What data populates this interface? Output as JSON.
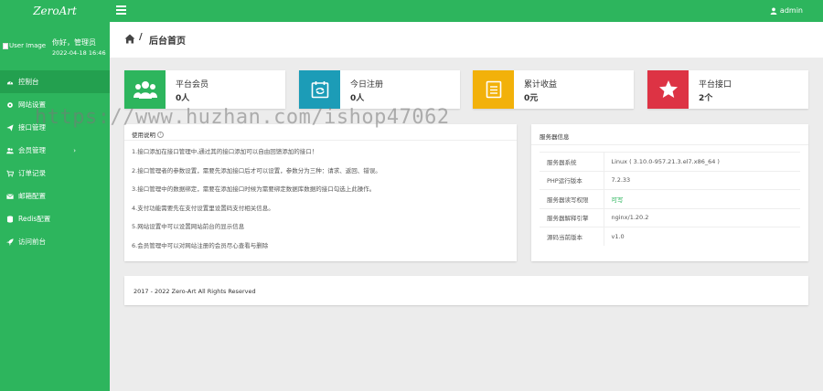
{
  "app": {
    "logo": "ZeroArt"
  },
  "topbar": {
    "user_name": "admin"
  },
  "sidebar": {
    "avatar_alt": "User Image",
    "greeting": "你好，管理员",
    "datetime": "2022-04-18 16:46",
    "items": [
      {
        "label": "控制台",
        "icon": "dashboard-icon",
        "active": true
      },
      {
        "label": "网站设置",
        "icon": "gear-icon"
      },
      {
        "label": "接口管理",
        "icon": "paper-plane-icon"
      },
      {
        "label": "会员管理",
        "icon": "users-icon",
        "has_submenu": true
      },
      {
        "label": "订单记录",
        "icon": "cart-icon"
      },
      {
        "label": "邮箱配置",
        "icon": "envelope-icon"
      },
      {
        "label": "Redis配置",
        "icon": "database-icon"
      },
      {
        "label": "访问前台",
        "icon": "rocket-icon"
      }
    ]
  },
  "header": {
    "separator": "/",
    "title": "后台首页"
  },
  "stats": [
    {
      "label": "平台会员",
      "value": "0人",
      "color": "#2db55d",
      "icon": "users-icon"
    },
    {
      "label": "今日注册",
      "value": "0人",
      "color": "#1c9cb7",
      "icon": "calendar-icon"
    },
    {
      "label": "累计收益",
      "value": "0元",
      "color": "#f2b10a",
      "icon": "document-icon"
    },
    {
      "label": "平台接口",
      "value": "2个",
      "color": "#dd3344",
      "icon": "star-icon"
    }
  ],
  "usage": {
    "title": "使用说明",
    "items": [
      "1.接口添加在接口管理中,通过其的接口添加可以自由回馈添加的接口！",
      "2.接口管理者的参数设置，需要先添加接口后才可以设置，参数分为三种：请求、返回、错误。",
      "3.接口管理中的数据绑定，需要在添加接口时候为需要绑定数据库数据的接口勾选上此操作。",
      "4.支付功能需要先在支付设置里设置码支付相关信息。",
      "5.网站设置中可以设置网站前台的显示信息",
      "6.会员管理中可以对网站注册的会员尽心查看与删除"
    ]
  },
  "server": {
    "title": "服务器信息",
    "rows": [
      {
        "key": "服务器系统",
        "value": "Linux ( 3.10.0-957.21.3.el7.x86_64 )"
      },
      {
        "key": "PHP运行版本",
        "value": "7.2.33"
      },
      {
        "key": "服务器读写权限",
        "value": "可写",
        "ok": true
      },
      {
        "key": "服务器解释引擎",
        "value": "nginx/1.20.2"
      },
      {
        "key": "源码当前版本",
        "value": "v1.0"
      }
    ]
  },
  "footer": {
    "copyright": "2017 - 2022 Zero-Art All Rights Reserved"
  },
  "watermark": "https://www.huzhan.com/ishop47062",
  "colors": {
    "brand": "#2db55d",
    "brand_dark": "#23a04f",
    "background": "#ececec"
  }
}
